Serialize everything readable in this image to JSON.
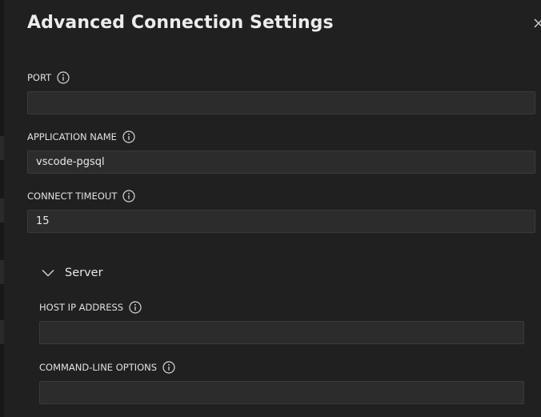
{
  "dialog": {
    "title": "Advanced Connection Settings",
    "close_icon": "close-icon"
  },
  "fields": {
    "port": {
      "label": "PORT",
      "value": ""
    },
    "application_name": {
      "label": "APPLICATION NAME",
      "value": "vscode-pgsql"
    },
    "connect_timeout": {
      "label": "CONNECT TIMEOUT",
      "value": "15"
    }
  },
  "server_section": {
    "title": "Server",
    "expanded": true,
    "fields": {
      "host_ip_address": {
        "label": "HOST IP ADDRESS",
        "value": ""
      },
      "command_line_options": {
        "label": "COMMAND-LINE OPTIONS",
        "value": ""
      }
    }
  },
  "colors": {
    "panel": "#202020",
    "input_bg": "#2c2c2c",
    "input_border": "#3a3a3a",
    "text": "#e6e6e6"
  }
}
